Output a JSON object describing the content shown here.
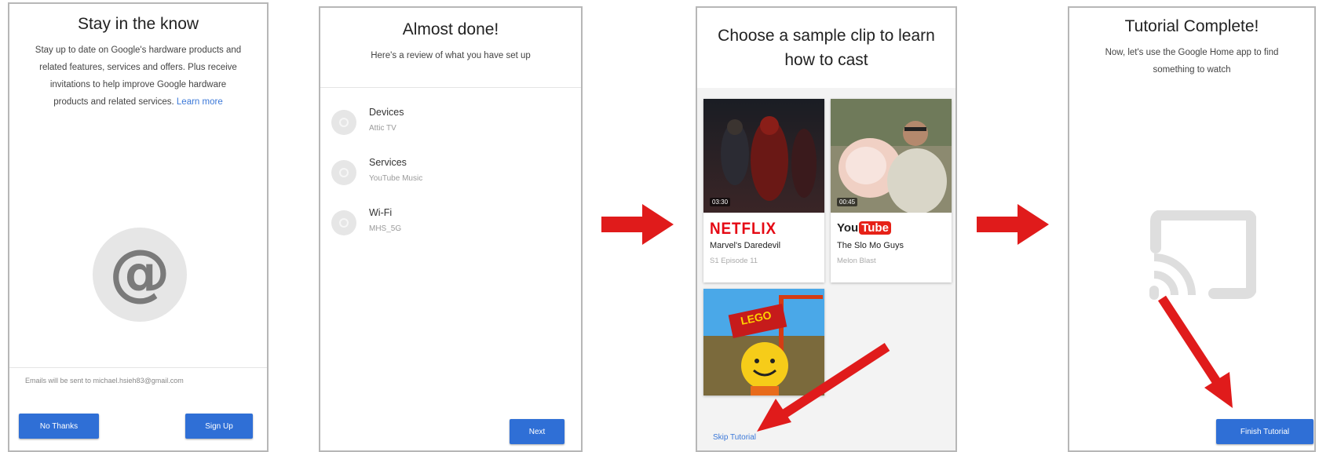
{
  "screen1": {
    "title": "Stay in the know",
    "body": "Stay up to date on Google's hardware products and related features, services and offers. Plus receive invitations to help improve Google hardware products and related services.",
    "learn_more": "Learn more",
    "email_note": "Emails will be sent to michael.hsieh83@gmail.com",
    "no_thanks": "No Thanks",
    "sign_up": "Sign Up"
  },
  "screen2": {
    "title": "Almost done!",
    "subtitle": "Here's a review of what you have set up",
    "items": [
      {
        "label": "Devices",
        "value": "Attic TV"
      },
      {
        "label": "Services",
        "value": "YouTube Music"
      },
      {
        "label": "Wi-Fi",
        "value": "MHS_5G"
      }
    ],
    "next": "Next"
  },
  "screen3": {
    "title": "Choose a sample clip to learn how to cast",
    "clips": [
      {
        "provider": "NETFLIX",
        "name": "Marvel's Daredevil",
        "meta": "S1 Episode 11",
        "duration": "03:30"
      },
      {
        "provider_you": "You",
        "provider_tube": "Tube",
        "name": "The Slo Mo Guys",
        "meta": "Melon Blast",
        "duration": "00:45"
      },
      {
        "poster_text": "LEGO"
      }
    ],
    "skip": "Skip Tutorial"
  },
  "screen4": {
    "title": "Tutorial Complete!",
    "subtitle": "Now, let's use the Google Home app to find something to watch",
    "finish": "Finish Tutorial"
  },
  "colors": {
    "accent": "#2f6fd6",
    "arrow": "#e01b1b",
    "netflix": "#e50914",
    "youtube": "#e62117"
  },
  "icons": [
    "at-sign-icon",
    "devices-icon",
    "services-icon",
    "wifi-icon",
    "cast-icon",
    "red-arrow-icon"
  ]
}
